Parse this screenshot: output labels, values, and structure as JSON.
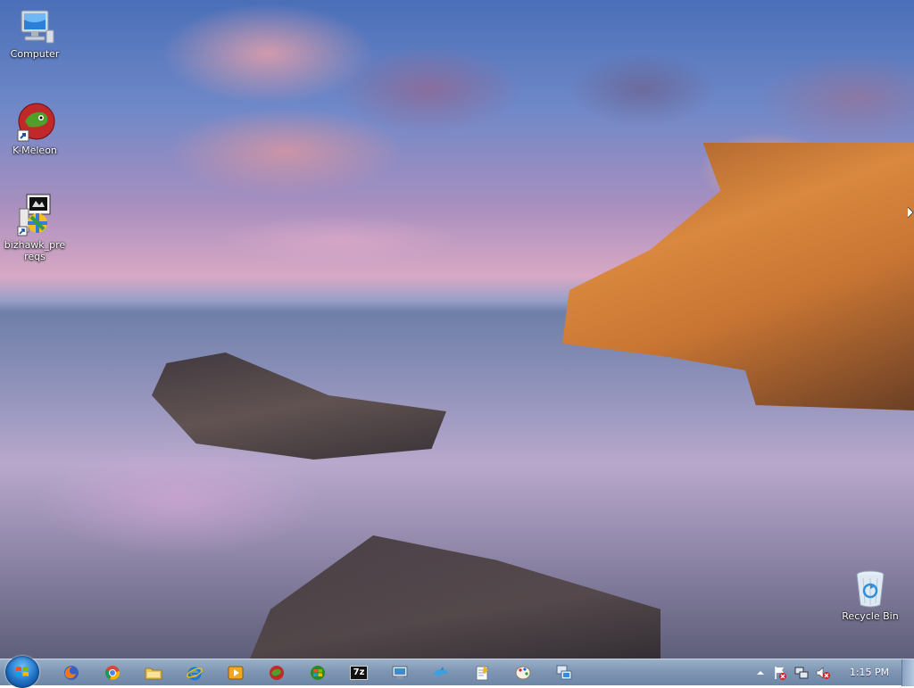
{
  "desktop": {
    "icons": [
      {
        "label": "Computer",
        "icon": "computer-icon"
      },
      {
        "label": "K-Meleon",
        "icon": "k-meleon-icon"
      },
      {
        "label": "bizhawk_prereqs",
        "icon": "installer-icon"
      },
      {
        "label": "Recycle Bin",
        "icon": "recycle-bin-icon"
      }
    ]
  },
  "taskbar": {
    "pinned": [
      {
        "icon": "firefox-icon"
      },
      {
        "icon": "chrome-icon"
      },
      {
        "icon": "file-explorer-icon"
      },
      {
        "icon": "internet-explorer-icon"
      },
      {
        "icon": "media-player-icon"
      },
      {
        "icon": "k-meleon-icon"
      },
      {
        "icon": "windows-media-icon"
      },
      {
        "icon": "7zip-icon",
        "text": "7z"
      },
      {
        "icon": "remote-desktop-icon"
      },
      {
        "icon": "dolphin-icon"
      },
      {
        "icon": "notepad-icon"
      },
      {
        "icon": "paint-icon"
      },
      {
        "icon": "network-app-icon"
      }
    ],
    "tray": {
      "icons": [
        "show-hidden-icons-chevron-icon",
        "action-center-icon",
        "network-icon",
        "volume-muted-icon"
      ],
      "clock": "1:15 PM"
    }
  },
  "colors": {
    "taskbar": "#7f97b4",
    "sky": "#6f88c8",
    "cliff": "#d9883e"
  }
}
